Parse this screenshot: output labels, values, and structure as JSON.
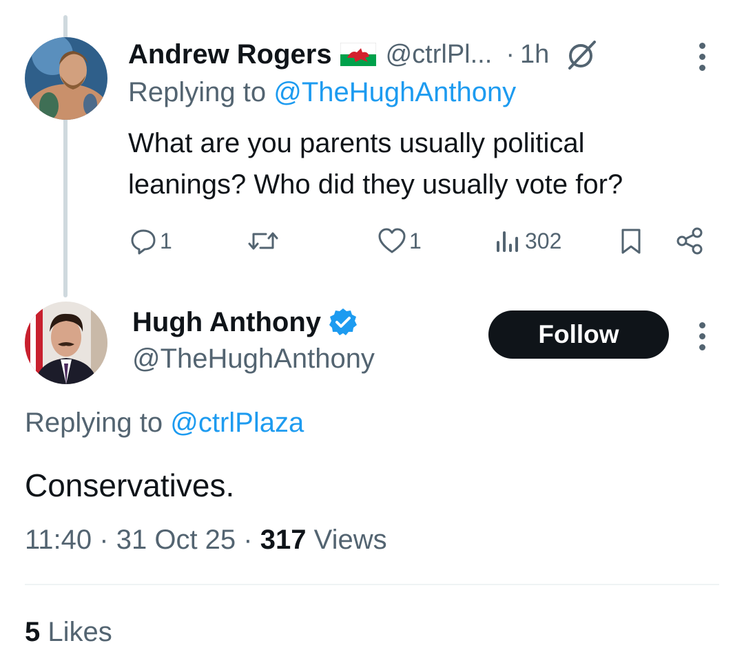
{
  "parent_tweet": {
    "author_name": "Andrew Rogers",
    "handle": "@ctrlPl...",
    "separator": "·",
    "time": "1h",
    "replying_prefix": "Replying to",
    "replying_to": "@TheHughAnthony",
    "text_line1": "What are you parents usually political",
    "text_line2": "leanings? Who did they usually vote for?",
    "replies": "1",
    "likes": "1",
    "views": "302"
  },
  "main_tweet": {
    "author_name": "Hugh Anthony",
    "handle": "@TheHughAnthony",
    "follow_label": "Follow",
    "replying_prefix": "Replying to",
    "replying_to": "@ctrlPlaza",
    "text": "Conservatives.",
    "time": "11:40",
    "date": "31 Oct 25",
    "separator": "·",
    "views_count": "317",
    "views_label": "Views"
  },
  "likes_summary": {
    "count": "5",
    "label": "Likes"
  },
  "colors": {
    "link": "#1d9bf0",
    "muted": "#536471",
    "verified": "#1d9bf0",
    "button": "#0f1419"
  }
}
